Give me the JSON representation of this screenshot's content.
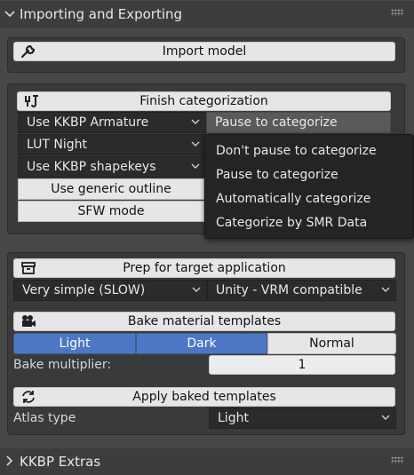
{
  "sections": {
    "import_export": {
      "title": "Importing and Exporting"
    },
    "extras": {
      "title": "KKBP Extras"
    }
  },
  "import": {
    "button_label": "Import model"
  },
  "categorization": {
    "finish_label": "Finish categorization",
    "armature_value": "Use KKBP Armature",
    "lut_value": "LUT Night",
    "shapekeys_value": "Use KKBP shapekeys",
    "outline_label": "Use generic outline",
    "sfw_label": "SFW mode",
    "pause_value": "Pause to categorize",
    "pause_options": [
      "Don't pause to categorize",
      "Pause to categorize",
      "Automatically categorize",
      "Categorize by SMR Data"
    ]
  },
  "target": {
    "prep_label": "Prep for target application",
    "simplify_value": "Very simple (SLOW)",
    "app_value": "Unity - VRM compatible"
  },
  "bake": {
    "bake_label": "Bake material templates",
    "light_label": "Light",
    "dark_label": "Dark",
    "normal_label": "Normal",
    "multiplier_label": "Bake multiplier:",
    "multiplier_value": "1"
  },
  "apply": {
    "apply_label": "Apply baked templates",
    "atlas_label": "Atlas type",
    "atlas_value": "Light"
  },
  "colors": {
    "accent": "#4d77c4",
    "background": "#474747",
    "panel": "#3a3a3a"
  }
}
